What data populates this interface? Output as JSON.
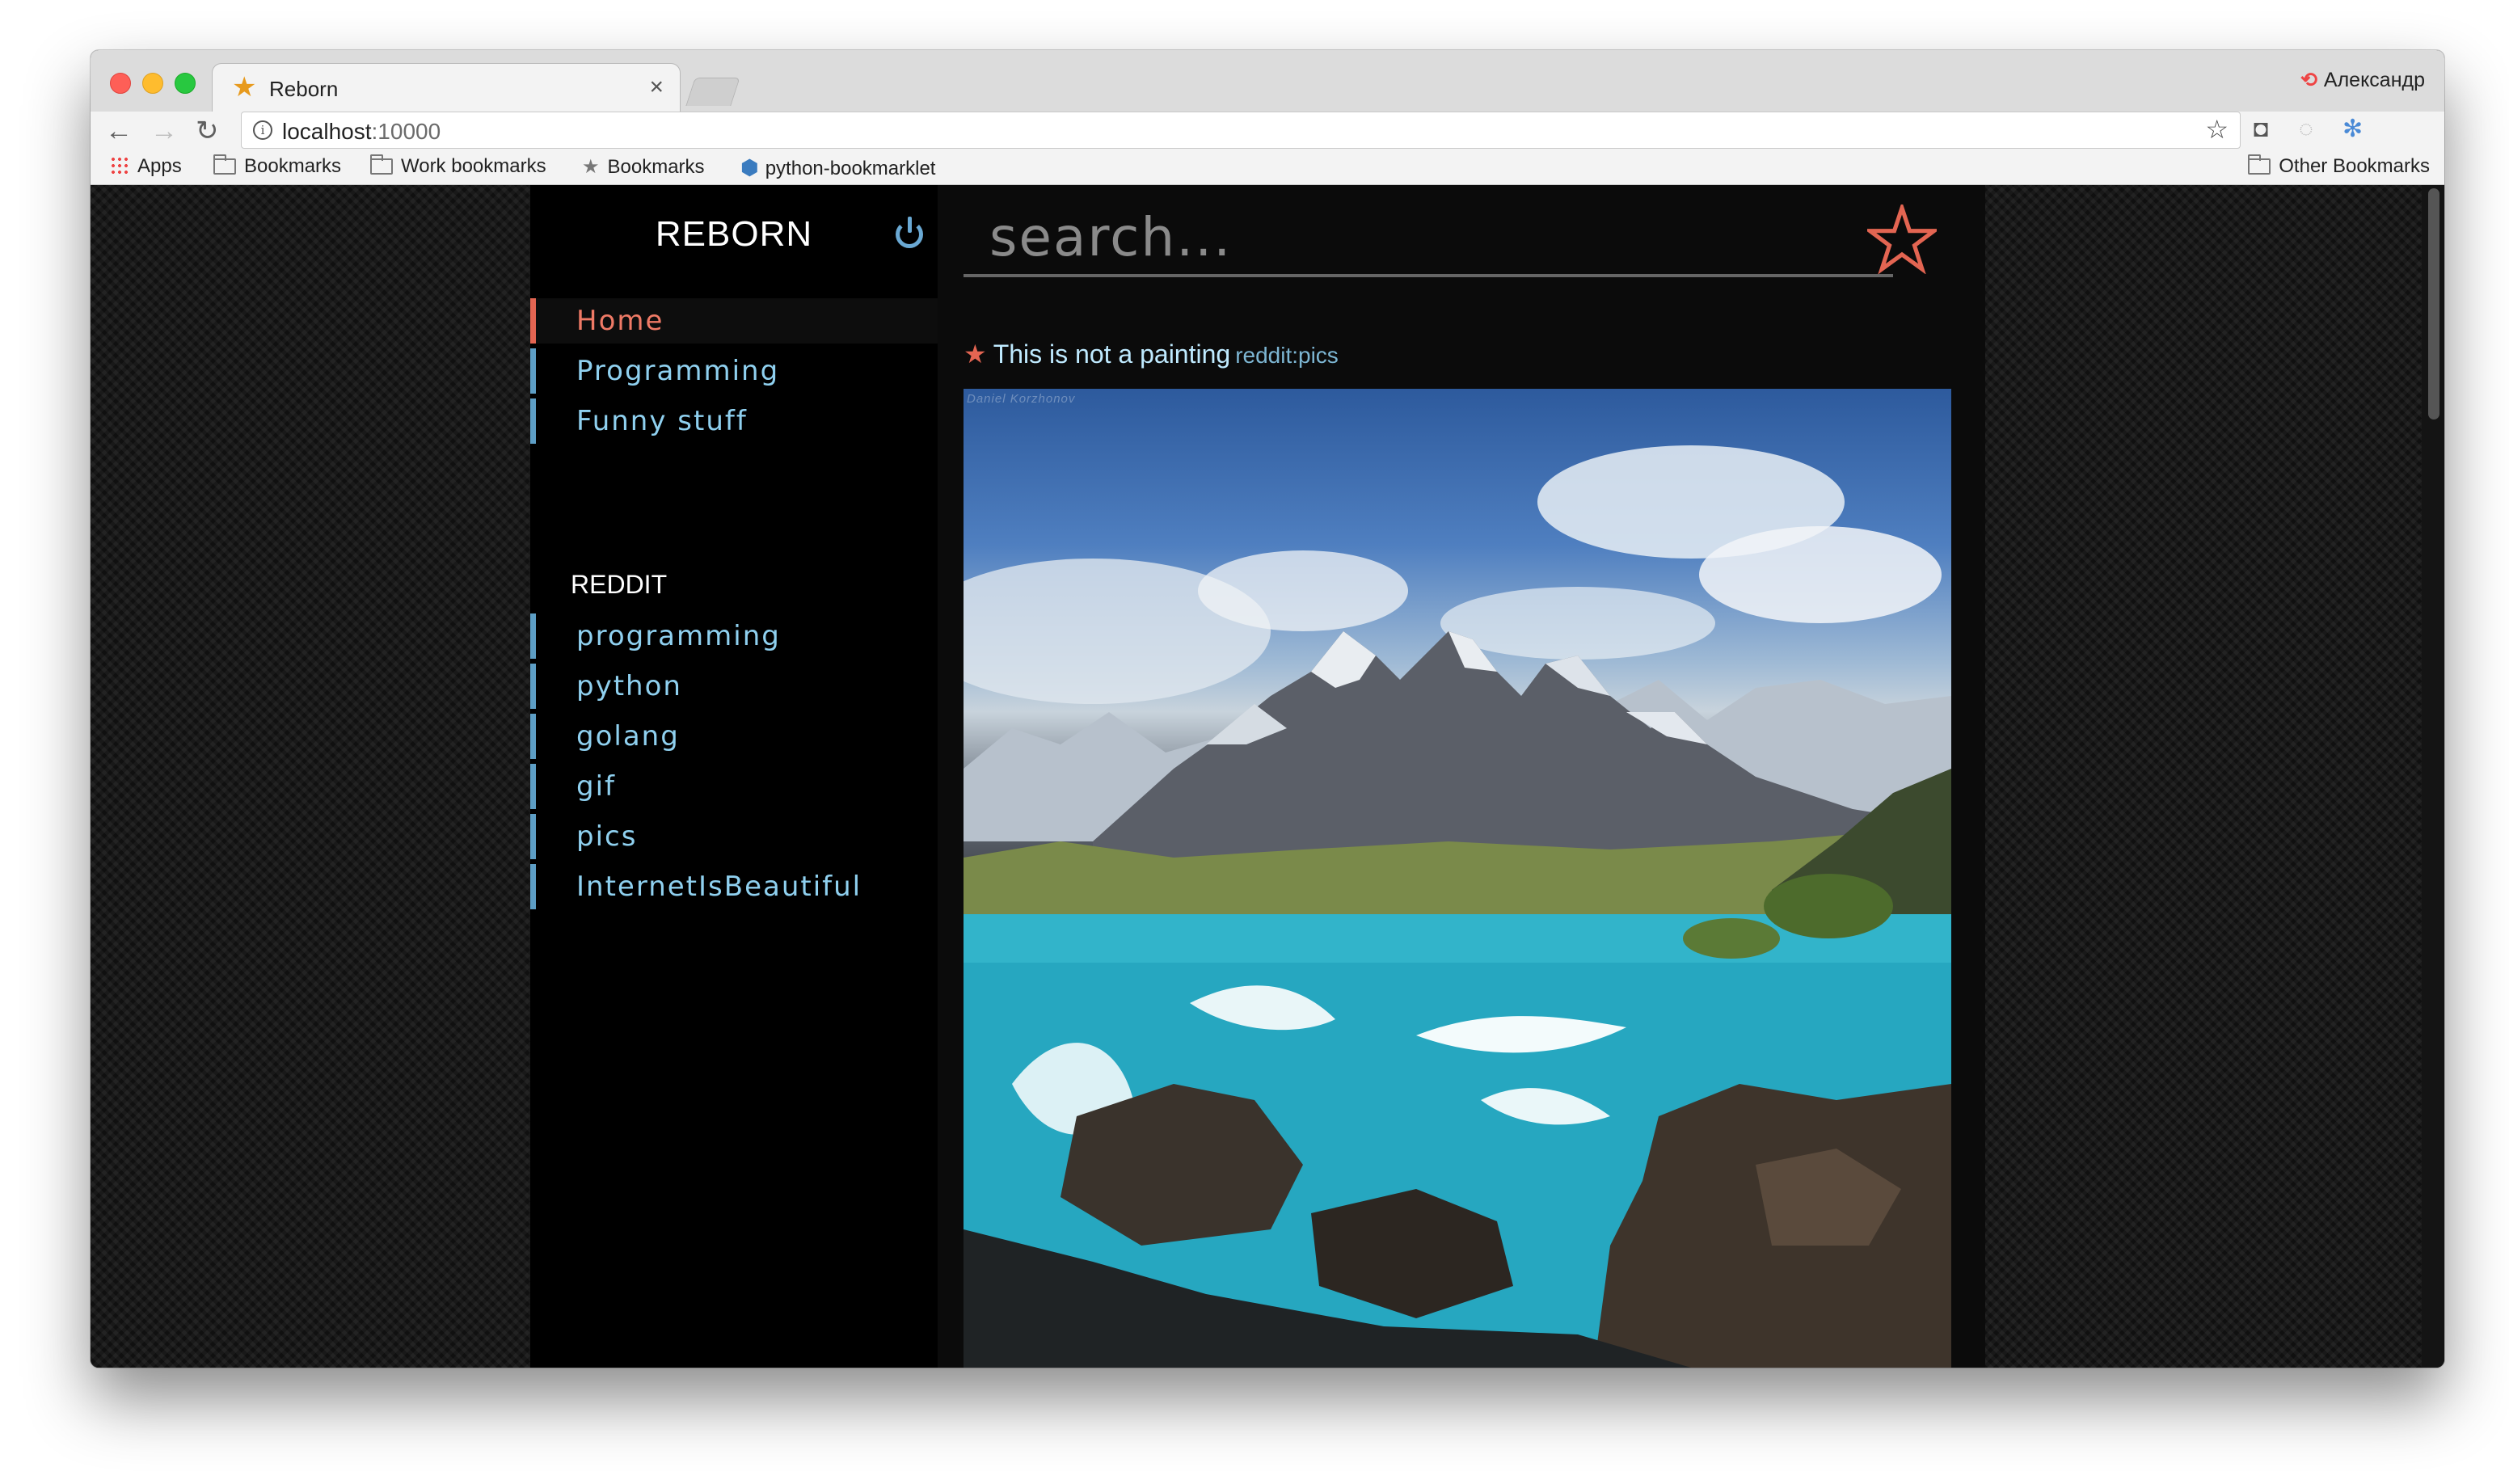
{
  "browser": {
    "tab_title": "Reborn",
    "profile_name": "Александр",
    "url_host": "localhost",
    "url_port": ":10000",
    "bookmarks": [
      {
        "label": "Apps",
        "icon": "apps-grid-icon"
      },
      {
        "label": "Bookmarks",
        "icon": "folder-icon"
      },
      {
        "label": "Work bookmarks",
        "icon": "folder-icon"
      },
      {
        "label": "Bookmarks",
        "icon": "star-icon"
      },
      {
        "label": "python-bookmarklet",
        "icon": "python-icon"
      }
    ],
    "other_bookmarks": "Other Bookmarks"
  },
  "sidebar": {
    "logo": "REBORN",
    "nav": [
      {
        "label": "Home",
        "active": true
      },
      {
        "label": "Programming"
      },
      {
        "label": "Funny stuff"
      }
    ],
    "reddit_title": "REDDIT",
    "reddit": [
      {
        "label": "programming"
      },
      {
        "label": "python"
      },
      {
        "label": "golang"
      },
      {
        "label": "gif"
      },
      {
        "label": "pics"
      },
      {
        "label": "InternetIsBeautiful"
      }
    ]
  },
  "search": {
    "placeholder": "search..."
  },
  "post": {
    "title": "This is not a painting",
    "source": "reddit:pics",
    "watermark": "Daniel Korzhonov"
  },
  "colors": {
    "accent": "#e36552",
    "link": "#8fd0ef",
    "sidebar_border": "#5d9ec5"
  }
}
